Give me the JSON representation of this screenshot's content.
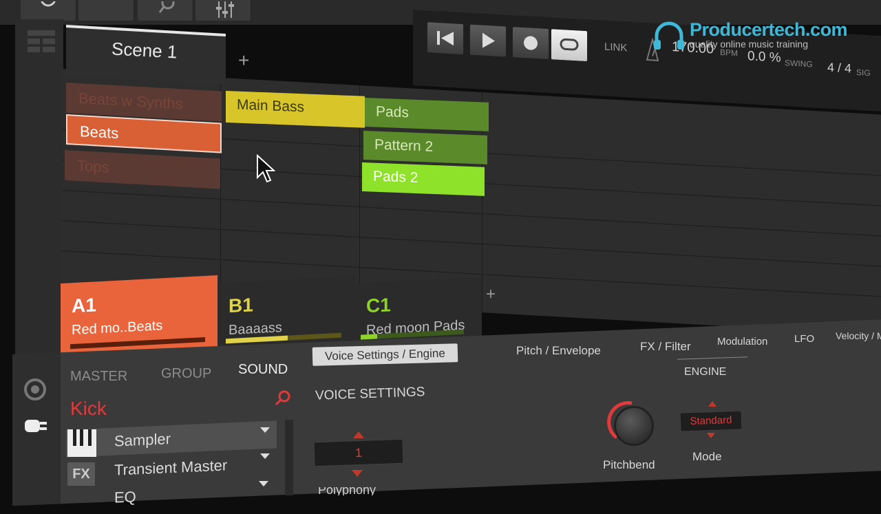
{
  "watermark": {
    "title": "Producertech.com",
    "subtitle": "quality online music training"
  },
  "transport": {
    "link_label": "LINK",
    "tempo": "170.00",
    "tempo_unit": "BPM",
    "swing": "0.0 %",
    "swing_label": "SWING",
    "signature": "4 / 4",
    "signature_label": "SIG"
  },
  "arranger": {
    "scene_tab": "Scene 1",
    "add_scene": "+",
    "group_rows": [
      "Beats w Synths",
      "Beats",
      "Tops"
    ],
    "patterns": {
      "b": [
        "Main Bass"
      ],
      "c": [
        "Pads",
        "Pattern 2",
        "Pads 2"
      ]
    }
  },
  "groups": [
    {
      "id": "A1",
      "name": "Red mo..Beats",
      "color": "#e9643a",
      "label_color": "#ffffff"
    },
    {
      "id": "B1",
      "name": "Baaaass",
      "color": "#2b2b2b",
      "label_color": "#e0d34a"
    },
    {
      "id": "C1",
      "name": "Red moon Pads",
      "color": "#2b2b2b",
      "label_color": "#8fd22c"
    }
  ],
  "add_group": "+",
  "bottom": {
    "level_tabs": [
      "MASTER",
      "GROUP",
      "SOUND"
    ],
    "sound_name": "Kick",
    "plugins": [
      "Sampler",
      "Transient Master",
      "EQ"
    ],
    "fx_label": "FX",
    "param_tabs": [
      "Voice Settings / Engine",
      "Pitch / Envelope",
      "FX / Filter",
      "Modulation",
      "LFO",
      "Velocity / M"
    ],
    "section_voice": "VOICE SETTINGS",
    "section_engine": "ENGINE",
    "voices_value": "1",
    "voice_mode_partial": "Polyphony",
    "pitchbend_label": "Pitchbend",
    "mode_value": "Standard",
    "mode_label": "Mode"
  },
  "colors": {
    "accent_orange": "#e9643a",
    "group_yellow": "#e0d34a",
    "pad_green": "#8fd22c",
    "record_red": "#e23a3a"
  }
}
